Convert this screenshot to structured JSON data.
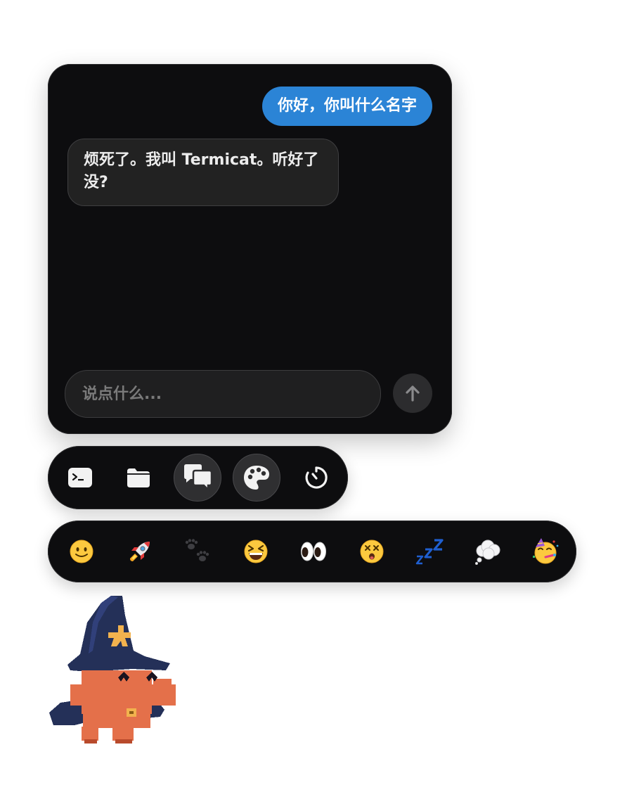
{
  "chat": {
    "messages": [
      {
        "role": "user",
        "text": "你好，你叫什么名字"
      },
      {
        "role": "bot",
        "text": "烦死了。我叫 Termicat。听好了没?"
      }
    ],
    "input_placeholder": "说点什么...",
    "send_icon": "arrow-up-icon"
  },
  "toolbar": {
    "tools": [
      {
        "name": "terminal",
        "icon": "terminal-icon",
        "active": false
      },
      {
        "name": "folder",
        "icon": "folder-icon",
        "active": false
      },
      {
        "name": "chat",
        "icon": "chat-bubbles-icon",
        "active": true
      },
      {
        "name": "palette",
        "icon": "palette-icon",
        "active": true
      },
      {
        "name": "timer",
        "icon": "timer-icon",
        "active": false
      }
    ]
  },
  "emoji_bar": {
    "emojis": [
      "🙂",
      "🚀",
      "🐾",
      "😆",
      "👀",
      "😵",
      "💤",
      "💭",
      "🥳"
    ]
  },
  "mascot": {
    "icon": "wizard-cat-mascot"
  },
  "colors": {
    "panel_bg": "#0d0d0f",
    "user_bubble": "#2b84d6",
    "bot_bubble": "#222222",
    "mascot_body": "#e4704a",
    "mascot_hat": "#243058",
    "hat_star": "#f2b24e"
  }
}
